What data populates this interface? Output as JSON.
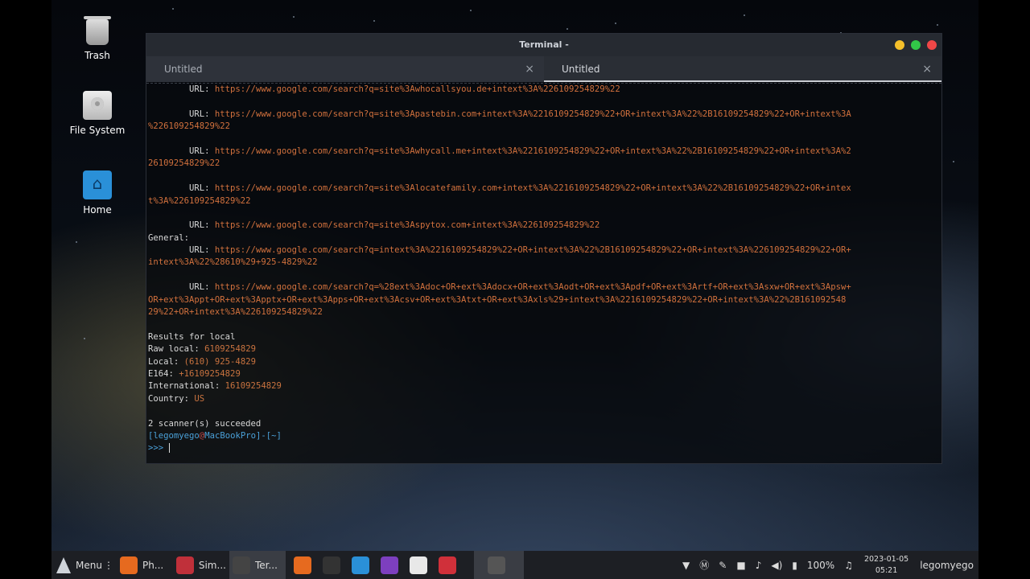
{
  "desktop_icons": [
    {
      "label": "Trash",
      "icon": "trash-icon"
    },
    {
      "label": "File System",
      "icon": "drive-icon"
    },
    {
      "label": "Home",
      "icon": "home-folder-icon"
    }
  ],
  "window": {
    "title": "Terminal -",
    "tabs": [
      {
        "label": "Untitled",
        "close": "×"
      },
      {
        "label": "Untitled",
        "close": "×"
      }
    ]
  },
  "terminal": {
    "lines": [
      {
        "parts": [
          {
            "t": "        URL: ",
            "c": ""
          },
          {
            "t": "https://www.google.com/search?q=site%3Awhocallsyou.de+intext%3A%226109254829%22",
            "c": "url"
          }
        ]
      },
      {
        "parts": []
      },
      {
        "parts": [
          {
            "t": "        URL: ",
            "c": ""
          },
          {
            "t": "https://www.google.com/search?q=site%3Apastebin.com+intext%3A%2216109254829%22+OR+intext%3A%22%2B16109254829%22+OR+intext%3A",
            "c": "url"
          }
        ]
      },
      {
        "parts": [
          {
            "t": "%226109254829%22",
            "c": "url"
          }
        ]
      },
      {
        "parts": []
      },
      {
        "parts": [
          {
            "t": "        URL: ",
            "c": ""
          },
          {
            "t": "https://www.google.com/search?q=site%3Awhycall.me+intext%3A%2216109254829%22+OR+intext%3A%22%2B16109254829%22+OR+intext%3A%2",
            "c": "url"
          }
        ]
      },
      {
        "parts": [
          {
            "t": "26109254829%22",
            "c": "url"
          }
        ]
      },
      {
        "parts": []
      },
      {
        "parts": [
          {
            "t": "        URL: ",
            "c": ""
          },
          {
            "t": "https://www.google.com/search?q=site%3Alocatefamily.com+intext%3A%2216109254829%22+OR+intext%3A%22%2B16109254829%22+OR+intex",
            "c": "url"
          }
        ]
      },
      {
        "parts": [
          {
            "t": "t%3A%226109254829%22",
            "c": "url"
          }
        ]
      },
      {
        "parts": []
      },
      {
        "parts": [
          {
            "t": "        URL: ",
            "c": ""
          },
          {
            "t": "https://www.google.com/search?q=site%3Aspytox.com+intext%3A%226109254829%22",
            "c": "url"
          }
        ]
      },
      {
        "parts": [
          {
            "t": "General:",
            "c": ""
          }
        ]
      },
      {
        "parts": [
          {
            "t": "        URL: ",
            "c": ""
          },
          {
            "t": "https://www.google.com/search?q=intext%3A%2216109254829%22+OR+intext%3A%22%2B16109254829%22+OR+intext%3A%226109254829%22+OR+",
            "c": "url"
          }
        ]
      },
      {
        "parts": [
          {
            "t": "intext%3A%22%28610%29+925-4829%22",
            "c": "url"
          }
        ]
      },
      {
        "parts": []
      },
      {
        "parts": [
          {
            "t": "        URL: ",
            "c": ""
          },
          {
            "t": "https://www.google.com/search?q=%28ext%3Adoc+OR+ext%3Adocx+OR+ext%3Aodt+OR+ext%3Apdf+OR+ext%3Artf+OR+ext%3Asxw+OR+ext%3Apsw+",
            "c": "url"
          }
        ]
      },
      {
        "parts": [
          {
            "t": "OR+ext%3Appt+OR+ext%3Apptx+OR+ext%3Apps+OR+ext%3Acsv+OR+ext%3Atxt+OR+ext%3Axls%29+intext%3A%2216109254829%22+OR+intext%3A%22%2B161092548",
            "c": "url"
          }
        ]
      },
      {
        "parts": [
          {
            "t": "29%22+OR+intext%3A%226109254829%22",
            "c": "url"
          }
        ]
      },
      {
        "parts": []
      },
      {
        "parts": [
          {
            "t": "Results for local",
            "c": ""
          }
        ]
      },
      {
        "parts": [
          {
            "t": "Raw local: ",
            "c": ""
          },
          {
            "t": "6109254829",
            "c": "val"
          }
        ]
      },
      {
        "parts": [
          {
            "t": "Local: ",
            "c": ""
          },
          {
            "t": "(610) 925-4829",
            "c": "val"
          }
        ]
      },
      {
        "parts": [
          {
            "t": "E164: ",
            "c": ""
          },
          {
            "t": "+16109254829",
            "c": "val"
          }
        ]
      },
      {
        "parts": [
          {
            "t": "International: ",
            "c": ""
          },
          {
            "t": "16109254829",
            "c": "val"
          }
        ]
      },
      {
        "parts": [
          {
            "t": "Country: ",
            "c": ""
          },
          {
            "t": "US",
            "c": "val"
          }
        ]
      },
      {
        "parts": []
      },
      {
        "parts": [
          {
            "t": "2 scanner(s) succeeded",
            "c": ""
          }
        ]
      },
      {
        "parts": [
          {
            "t": "[",
            "c": "prompt-b"
          },
          {
            "t": "legomyego",
            "c": "prompt-u"
          },
          {
            "t": "@",
            "c": "prompt-h"
          },
          {
            "t": "MacBookPro",
            "c": "prompt-u"
          },
          {
            "t": "]-[",
            "c": "prompt-b"
          },
          {
            "t": "~",
            "c": "prompt-b"
          },
          {
            "t": "]",
            "c": "prompt-b"
          }
        ]
      },
      {
        "parts": [
          {
            "t": ">>> ",
            "c": "prompt-b"
          }
        ],
        "cursor": true
      }
    ]
  },
  "taskbar": {
    "menu_label": "Menu",
    "items": [
      {
        "label": "Ph...",
        "icon": "firefox-icon",
        "color": "#e66a1f"
      },
      {
        "label": "Sim...",
        "icon": "record-icon",
        "color": "#c0303a"
      },
      {
        "label": "Ter...",
        "icon": "terminal-icon",
        "color": "#444",
        "active": true
      }
    ],
    "launchers": [
      {
        "icon": "firefox-icon",
        "color": "#e66a1f"
      },
      {
        "icon": "terminal-icon",
        "color": "#333"
      },
      {
        "icon": "files-icon",
        "color": "#2a90d8"
      },
      {
        "icon": "tor-icon",
        "color": "#7d3fbf"
      },
      {
        "icon": "text-editor-icon",
        "color": "#e8e8e8"
      },
      {
        "icon": "recorder-icon",
        "color": "#d0303a"
      },
      {
        "icon": "terminal-icon",
        "color": "#555",
        "active": true
      }
    ],
    "battery": "100%",
    "date": "2023-01-05",
    "time": "05:21",
    "user": "legomyego"
  }
}
